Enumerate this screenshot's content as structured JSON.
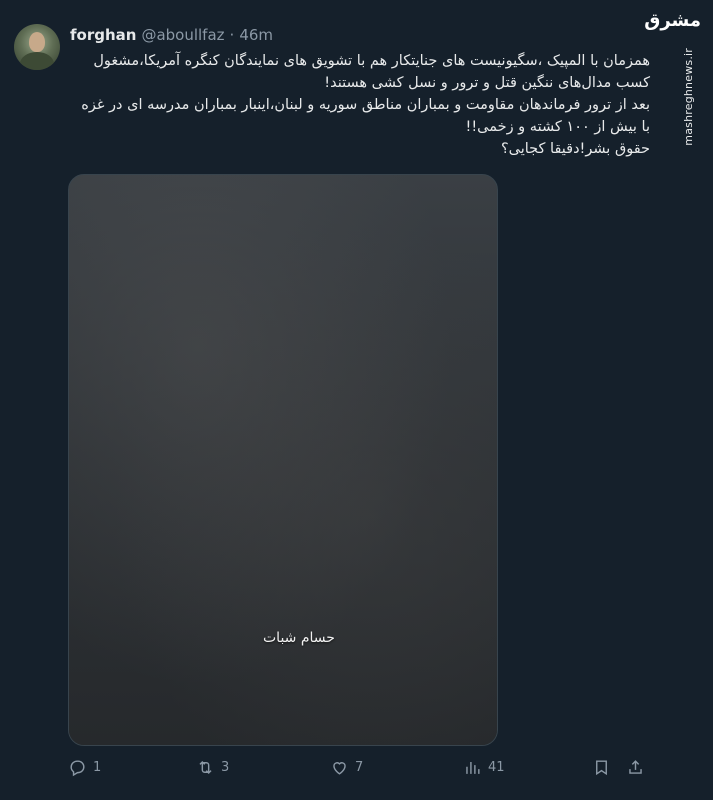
{
  "tweet": {
    "author_name": "forghan",
    "author_handle": "@aboullfaz",
    "separator": "·",
    "time": "46m",
    "paragraphs": [
      "همزمان با المپیک ،سگیونیست های جنایتکار هم با تشویق های نمایندگان کنگره آمریکا،مشغول کسب مدال‌های ننگین قتل و ترور و نسل کشی هستند!",
      "بعد از ترور فرماندهان مقاومت و بمباران مناطق سوریه و لبنان،اینبار بمباران مدرسه ای در غزه با بیش از ۱۰۰ کشته و زخمی!!",
      "حقوق بشر!دقیقا کجایی؟"
    ],
    "media_caption": "حسام شبات",
    "watermark_logo": "مشرق",
    "watermark_url": "mashreghnews.ir"
  },
  "actions": {
    "replies": "1",
    "retweets": "3",
    "likes": "7",
    "views": "41"
  },
  "colors": {
    "background": "#15202b",
    "text": "#e7e9ea",
    "muted": "#8b98a5",
    "border": "#38444d"
  }
}
